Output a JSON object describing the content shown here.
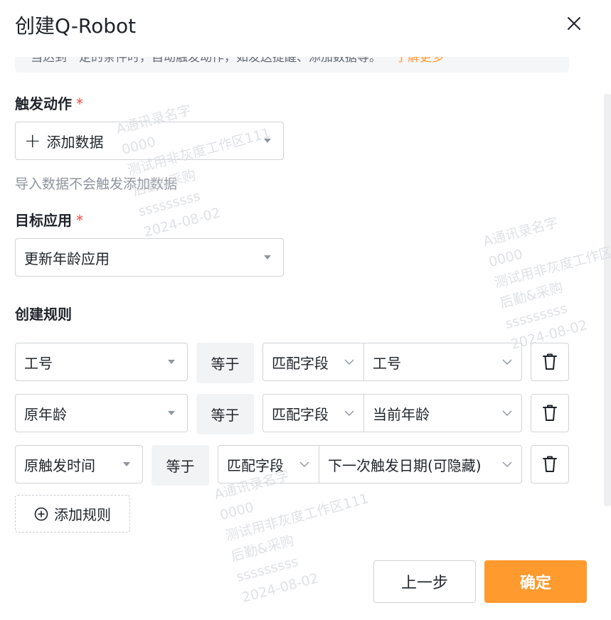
{
  "dialog": {
    "title": "创建Q-Robot",
    "hint_text": "当达到一定的条件时，自动触发动作，如发送提醒、添加数据等。",
    "hint_link": "了解更多"
  },
  "trigger_action": {
    "label": "触发动作",
    "required_mark": "*",
    "value": "添加数据",
    "helper": "导入数据不会触发添加数据"
  },
  "target_app": {
    "label": "目标应用",
    "required_mark": "*",
    "value": "更新年龄应用"
  },
  "rules": {
    "label": "创建规则",
    "items": [
      {
        "field": "工号",
        "operator": "等于",
        "match_type": "匹配字段",
        "match_field": "工号"
      },
      {
        "field": "原年龄",
        "operator": "等于",
        "match_type": "匹配字段",
        "match_field": "当前年龄"
      },
      {
        "field": "原触发时间",
        "operator": "等于",
        "match_type": "匹配字段",
        "match_field": "下一次触发日期(可隐藏)"
      }
    ],
    "add_label": "添加规则"
  },
  "footer": {
    "prev_label": "上一步",
    "confirm_label": "确定"
  },
  "watermark": {
    "lines": [
      "A通讯录名字",
      "0000",
      "测试用非灰度工作区111",
      "后勤&采购",
      "sssssssss",
      "2024-08-02"
    ]
  },
  "colors": {
    "accent": "#ff9a2e",
    "required": "#f54a45",
    "border": "#d0d3d6"
  },
  "icons": [
    "close-icon",
    "plus-icon",
    "caret-down-icon",
    "chevron-down-icon",
    "trash-icon",
    "plus-circle-icon"
  ]
}
